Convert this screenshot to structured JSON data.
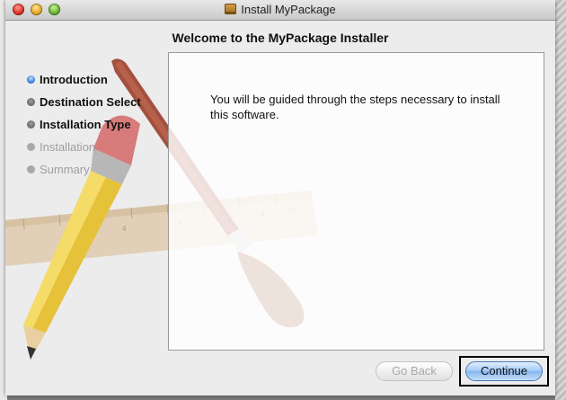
{
  "window": {
    "title": "Install MyPackage",
    "icon": "package-icon"
  },
  "heading": "Welcome to the MyPackage Installer",
  "steps": [
    {
      "label": "Introduction",
      "state": "current"
    },
    {
      "label": "Destination Select",
      "state": "enabled"
    },
    {
      "label": "Installation Type",
      "state": "enabled"
    },
    {
      "label": "Installation",
      "state": "disabled"
    },
    {
      "label": "Summary",
      "state": "disabled"
    }
  ],
  "content": {
    "text": "You will be guided through the steps necessary to install this software."
  },
  "buttons": {
    "back": "Go Back",
    "continue": "Continue"
  },
  "colors": {
    "active_step": "#2f78d6",
    "default_button": "#86b6ee"
  }
}
